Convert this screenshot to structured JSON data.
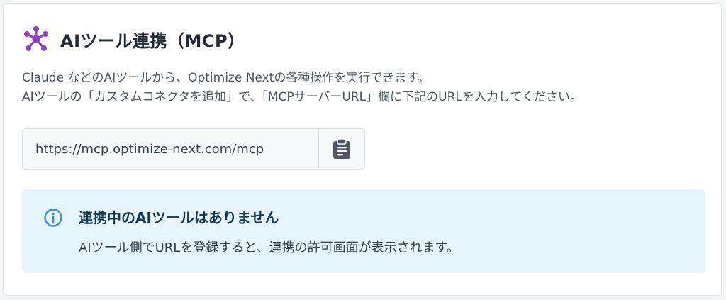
{
  "mcp_section": {
    "title": "AIツール連携（MCP）",
    "description_line1": "Claude などのAIツールから、Optimize Nextの各種操作を実行できます。",
    "description_line2": "AIツールの「カスタムコネクタを追加」で、「MCPサーバーURL」欄に下記のURLを入力してください。",
    "mcp_url": "https://mcp.optimize-next.com/mcp",
    "copy_icon": "clipboard-icon",
    "header_icon": "network-hub-icon"
  },
  "info_box": {
    "icon": "info-icon",
    "title": "連携中のAIツールはありません",
    "message": "AIツール側でURLを登録すると、連携の許可画面が表示されます。"
  },
  "colors": {
    "accent_purple": "#8e3ec3",
    "info_background": "#e6f5fb",
    "info_icon": "#3b8fd4",
    "info_title": "#163a4c"
  }
}
